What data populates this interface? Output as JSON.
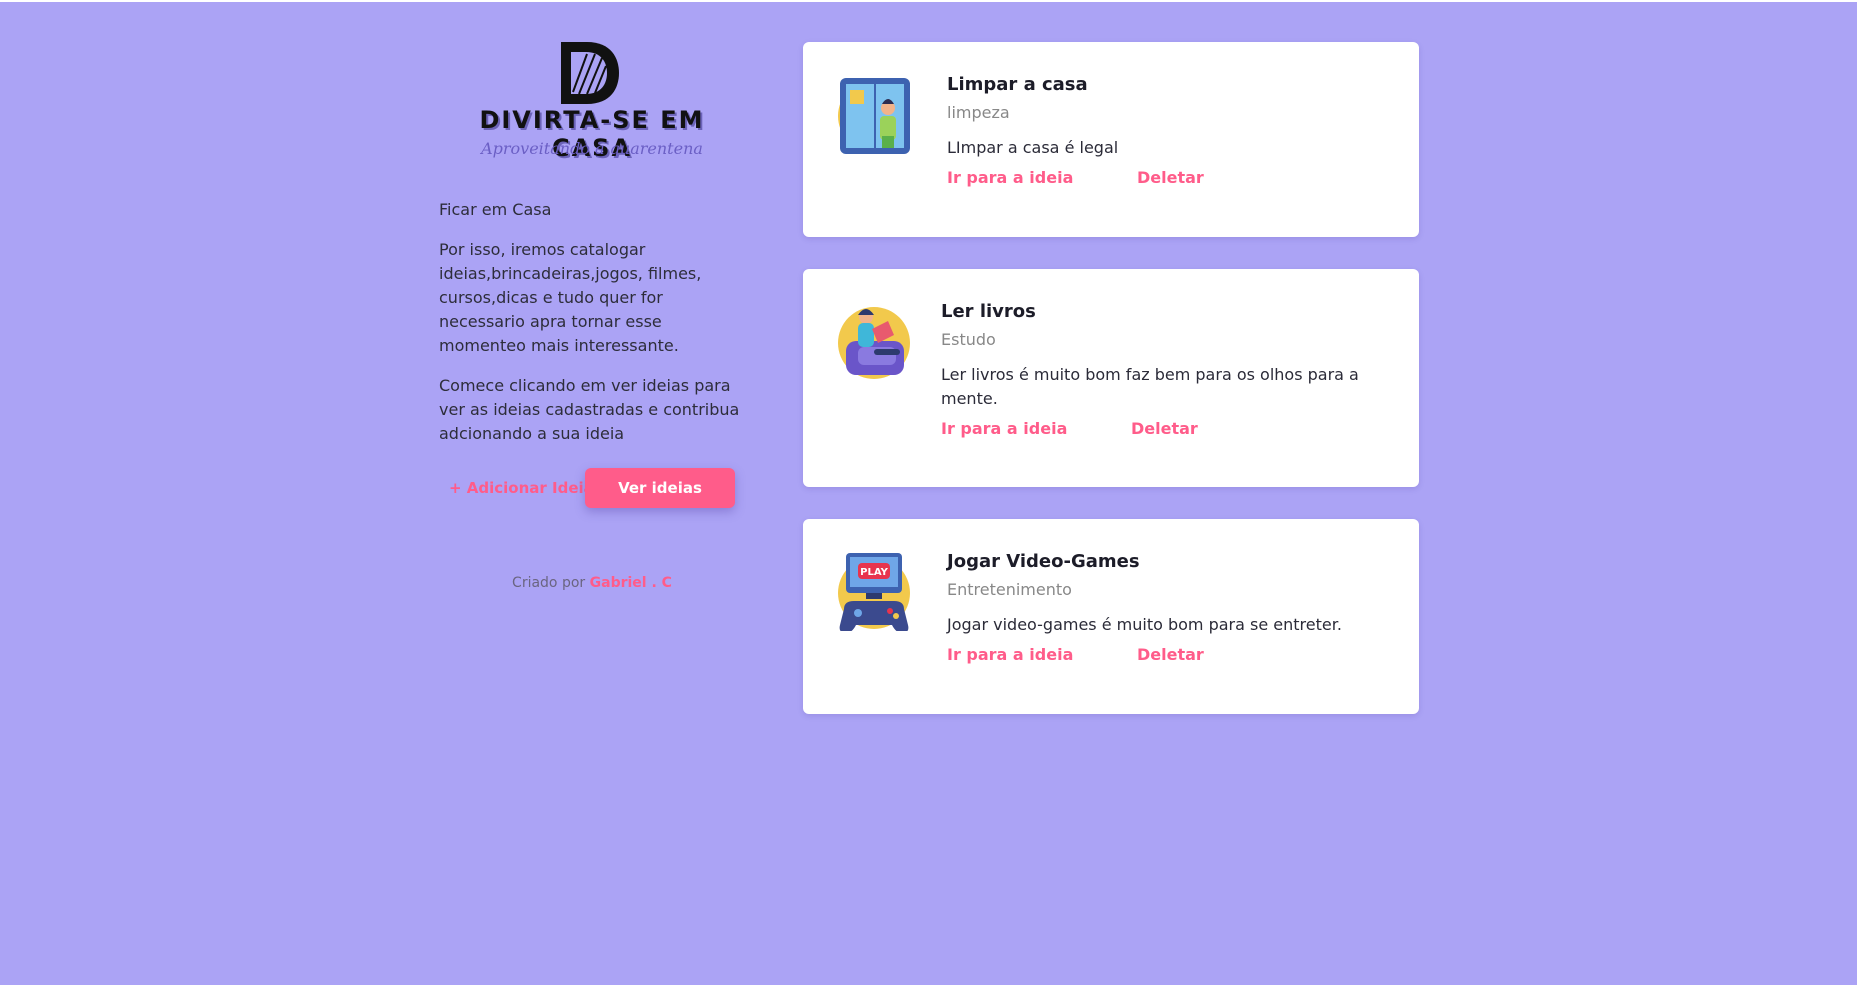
{
  "brand": {
    "letter": "D",
    "title": "DIVIRTA-SE EM CASA",
    "subtitle": "Aproveitando a quarentena"
  },
  "intro": {
    "p1": "Ficar em Casa",
    "p2": "Por isso, iremos catalogar ideias,brincadeiras,jogos, filmes, cursos,dicas e tudo quer for necessario apra tornar esse momenteo mais interessante.",
    "p3": "Comece clicando em ver ideias para ver as ideias cadastradas e contribua adcionando a sua ideia"
  },
  "actions": {
    "add_label": "+ Adicionar Ideia",
    "see_label": "Ver ideias"
  },
  "footer": {
    "prefix": "Criado por",
    "author": "Gabriel . C"
  },
  "colors": {
    "background": "#aba3f5",
    "accent": "#ff5c8a"
  },
  "ideas": [
    {
      "icon": "cleaning-icon",
      "title": "Limpar a casa",
      "category": "limpeza",
      "description": "LImpar a casa é legal",
      "go_label": "Ir para a ideia",
      "delete_label": "Deletar"
    },
    {
      "icon": "reading-icon",
      "title": "Ler livros",
      "category": "Estudo",
      "description": "Ler livros é muito bom faz bem para os olhos para a mente.",
      "go_label": "Ir para a ideia",
      "delete_label": "Deletar"
    },
    {
      "icon": "video-game-icon",
      "title": "Jogar Video-Games",
      "category": "Entretenimento",
      "description": "Jogar video-games é muito bom para se entreter.",
      "go_label": "Ir para a ideia",
      "delete_label": "Deletar",
      "icon_badge": "PLAY"
    }
  ]
}
